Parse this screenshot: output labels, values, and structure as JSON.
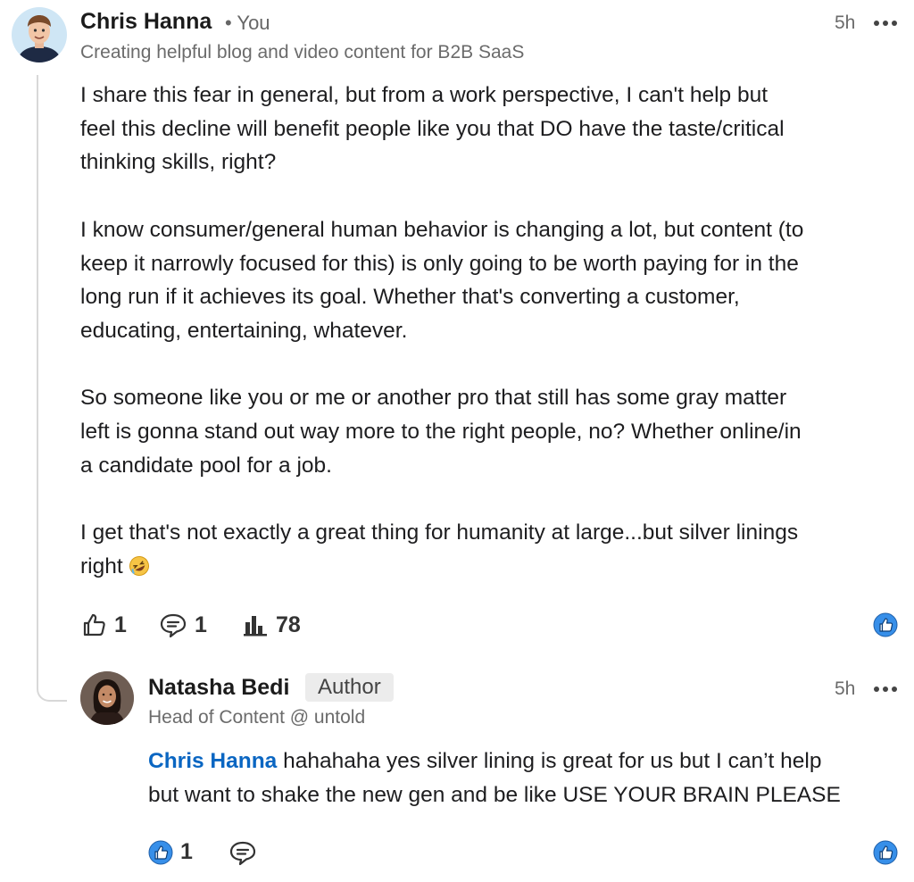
{
  "comment": {
    "author_name": "Chris Hanna",
    "you_label": "• You",
    "headline": "Creating helpful blog and video content for B2B SaaS",
    "time": "5h",
    "more_icon": "more-horizontal-icon",
    "paragraphs": [
      [
        "I share this fear in general, but from a work perspective, I can't help but",
        "feel this decline will benefit people like you that DO have the taste/critical",
        "thinking skills, right?"
      ],
      [
        "I know consumer/general human behavior is changing a lot, but content (to",
        "keep it narrowly focused for this) is only going to be worth paying for in the",
        "long run if it achieves its goal. Whether that's converting a customer,",
        "educating, entertaining, whatever."
      ],
      [
        "So someone like you or me or another pro that still has some gray matter",
        "left is gonna stand out way more to the right people, no? Whether online/in",
        "a candidate pool for a job."
      ],
      [
        "I get that's not exactly a great thing for humanity at large...but silver linings"
      ]
    ],
    "last_line": "right",
    "emoji": "rolling-on-floor-laughing-emoji",
    "reactions_count": "1",
    "replies_count": "1",
    "impressions_count": "78"
  },
  "reply": {
    "author_name": "Natasha Bedi",
    "author_badge": "Author",
    "headline": "Head of Content @ untold",
    "time": "5h",
    "mention": "Chris Hanna",
    "line1_rest": " hahahaha yes silver lining is great for us but I can’t help",
    "line2": "but want to shake the new gen and be like USE YOUR BRAIN PLEASE",
    "likes_count": "1"
  },
  "colors": {
    "accent": "#0a66c2",
    "like_blue": "#378fe9",
    "text": "#1d1d1f",
    "muted": "#6b6b6b",
    "thread": "#d8d8d8"
  }
}
